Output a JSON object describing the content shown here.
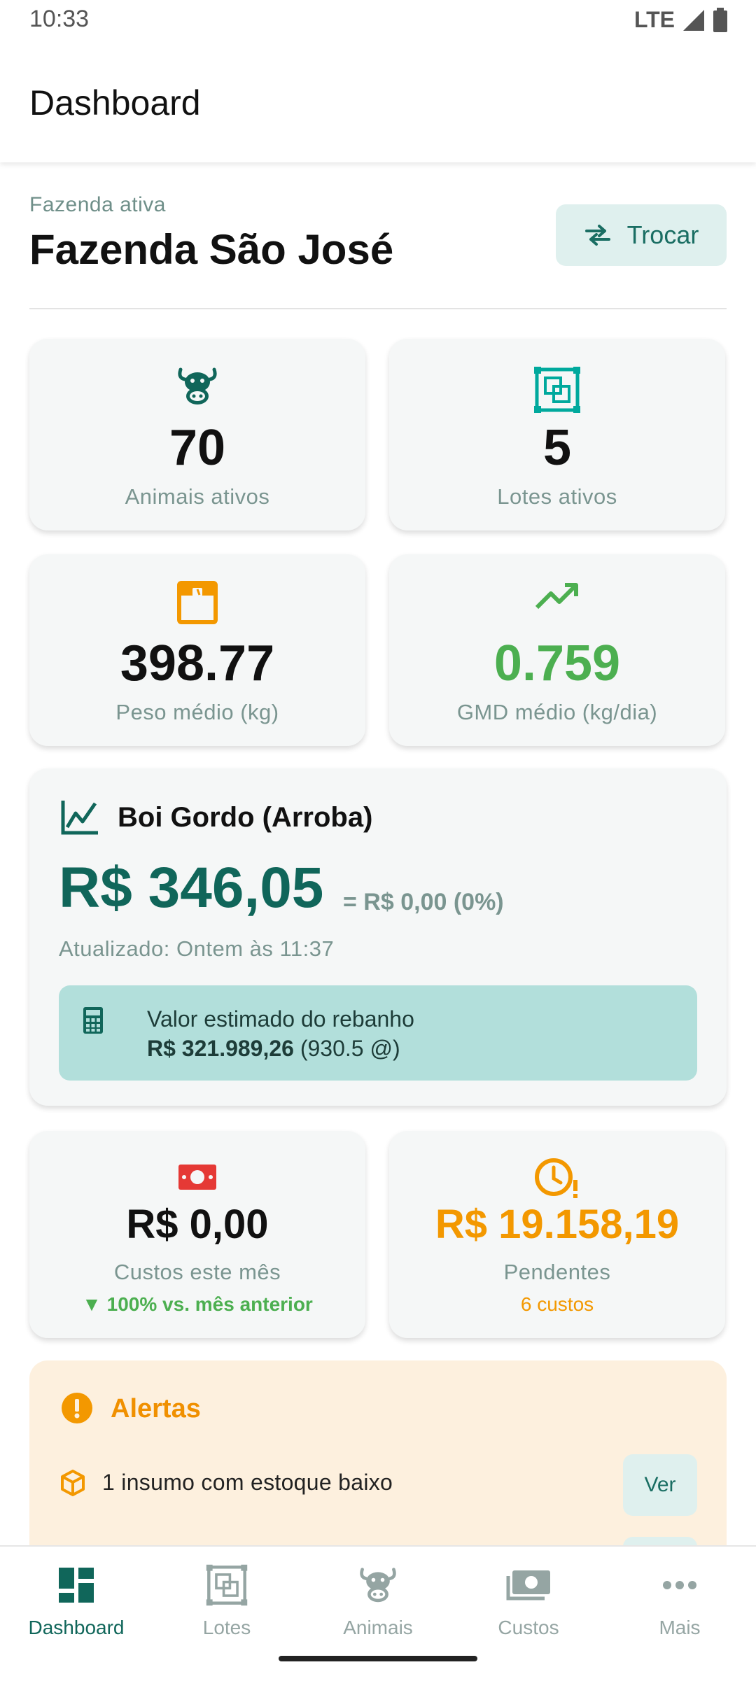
{
  "status_bar": {
    "time": "10:33",
    "network": "LTE"
  },
  "app_bar": {
    "title": "Dashboard"
  },
  "farm": {
    "label": "Fazenda ativa",
    "name": "Fazenda São José",
    "switch_label": "Trocar"
  },
  "stats": [
    {
      "value": "70",
      "label": "Animais ativos",
      "icon": "cow-icon"
    },
    {
      "value": "5",
      "label": "Lotes ativos",
      "icon": "lots-icon"
    },
    {
      "value": "398.77",
      "label": "Peso médio (kg)",
      "icon": "scale-icon"
    },
    {
      "value": "0.759",
      "label": "GMD médio (kg/dia)",
      "icon": "trending-up-icon"
    }
  ],
  "boi_gordo": {
    "title": "Boi Gordo (Arroba)",
    "price": "R$ 346,05",
    "change": "= R$ 0,00 (0%)",
    "updated": "Atualizado: Ontem às 11:37",
    "herd_value_label": "Valor estimado do rebanho",
    "herd_value": "R$ 321.989,26",
    "herd_arrobas": "(930.5 @)"
  },
  "costs": {
    "month_value": "R$ 0,00",
    "month_label": "Custos este mês",
    "month_comparison": "▼ 100% vs. mês anterior",
    "pending_value": "R$ 19.158,19",
    "pending_label": "Pendentes",
    "pending_count": "6 custos"
  },
  "alerts": {
    "title": "Alertas",
    "items": [
      {
        "text": "1 insumo com estoque baixo",
        "action": "Ver"
      }
    ]
  },
  "bottom_nav": [
    {
      "label": "Dashboard",
      "active": true
    },
    {
      "label": "Lotes",
      "active": false
    },
    {
      "label": "Animais",
      "active": false
    },
    {
      "label": "Custos",
      "active": false
    },
    {
      "label": "Mais",
      "active": false
    }
  ],
  "colors": {
    "primary": "#10665a",
    "green": "#4caf50",
    "orange": "#f39800",
    "red": "#e53935",
    "alert_bg": "#fdf0de",
    "info_box": "#b2dfdb"
  }
}
